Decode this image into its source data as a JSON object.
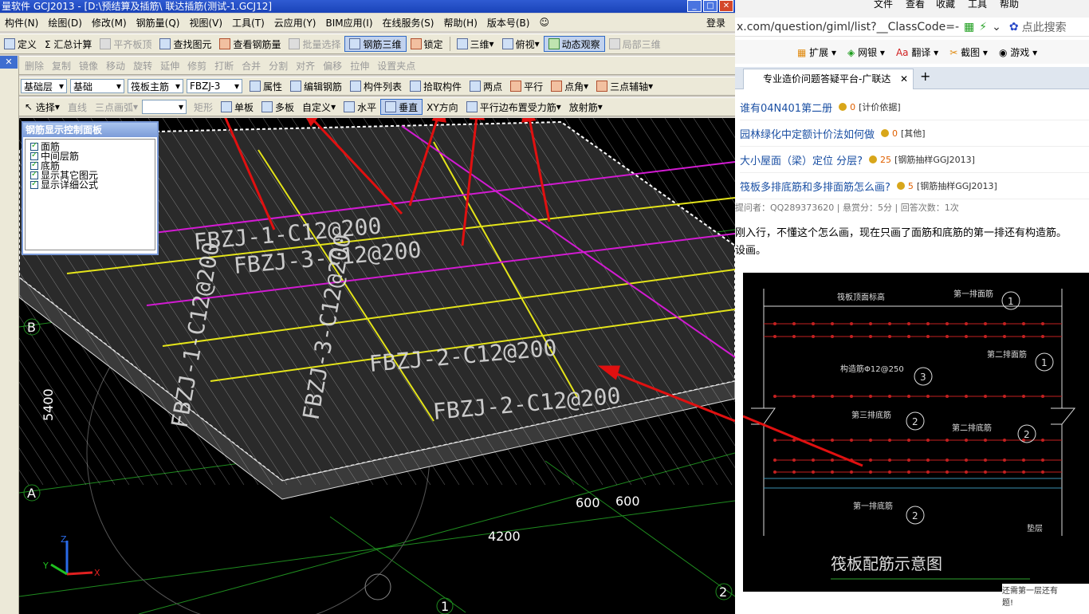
{
  "app": {
    "title": "量软件 GCJ2013 - [D:\\预结算及插筋\\ 联达插筋(测试-1.GCJ12]",
    "menus": [
      "构件(N)",
      "绘图(D)",
      "修改(M)",
      "钢筋量(Q)",
      "视图(V)",
      "工具(T)",
      "云应用(Y)",
      "BIM应用(I)",
      "在线服务(S)",
      "帮助(H)",
      "版本号(B)"
    ],
    "login": "登录",
    "toolbar1": {
      "define": "定义",
      "summary": "Σ 汇总计算",
      "flush": "平齐板顶",
      "find": "查找图元",
      "view_rebar": "查看钢筋量",
      "batch_select": "批量选择",
      "rebar3d": "钢筋三维",
      "lock": "锁定",
      "threed": "三维",
      "topview": "俯视",
      "dynamic": "动态观察",
      "local3d": "局部三维"
    },
    "toolbar2": [
      "删除",
      "复制",
      "镜像",
      "移动",
      "旋转",
      "延伸",
      "修剪",
      "打断",
      "合并",
      "分割",
      "对齐",
      "偏移",
      "拉伸",
      "设置夹点"
    ],
    "toolbar3": {
      "layer": "基础层",
      "category": "基础",
      "component": "筏板主筋",
      "name": "FBZJ-3",
      "props": "属性",
      "edit_rebar": "编辑钢筋",
      "comp_list": "构件列表",
      "pick": "拾取构件",
      "two_points": "两点",
      "parallel": "平行",
      "corner": "点角",
      "three_axis": "三点辅轴"
    },
    "toolbar4": {
      "select": "选择",
      "line": "直线",
      "arc": "三点画弧",
      "rect": "矩形",
      "single": "单板",
      "multi": "多板",
      "custom": "自定义",
      "horizontal": "水平",
      "vertical": "垂直",
      "xy": "XY方向",
      "parallel_edge": "平行边布置受力筋",
      "radial": "放射筋"
    },
    "panel": {
      "title": "钢筋显示控制面板",
      "items": [
        "面筋",
        "中间层筋",
        "底筋",
        "显示其它图元",
        "显示详细公式"
      ]
    },
    "viewport": {
      "labels": [
        "FBZJ-1-C12@200",
        "FBZJ-3-C12@200",
        "FBZJ-2-C12@200",
        "FBZJ-1-C12@200",
        "FBZJ-3-C12@200",
        "FBZJ-2-C12@200"
      ],
      "axis_b": "B",
      "axis_a": "A",
      "dim_5400": "5400",
      "dim_4200": "4200",
      "dim_600a": "600",
      "dim_600b": "600",
      "axis_1": "1",
      "axis_2": "2",
      "tri_x": "X",
      "tri_y": "Y",
      "tri_z": "Z"
    },
    "colors": {
      "grid": "#ffffff",
      "yellow": "#e4e41a",
      "magenta": "#d21ad2",
      "arrow": "#e01010",
      "green": "#1f8c1f"
    }
  },
  "browser": {
    "top": [
      "文件",
      "查看",
      "收藏",
      "工具",
      "帮助"
    ],
    "url": "x.com/question/giml/list?__ClassCode=-",
    "search": "点此搜索",
    "tools": [
      "扩展",
      "网银",
      "翻译",
      "截图",
      "游戏"
    ],
    "tab": "专业造价问题答疑平台-广联达",
    "questions": [
      {
        "title": "谁有04N401第二册",
        "points": "0",
        "tag": "[计价依据]"
      },
      {
        "title": "园林绿化中定额计价法如何做",
        "points": "0",
        "tag": "[其他]"
      },
      {
        "title": "大小屋面（梁）定位 分层?",
        "points": "25",
        "tag": "[钢筋抽样GGJ2013]"
      },
      {
        "title": "筏板多排底筋和多排面筋怎么画?",
        "points": "5",
        "tag": "[钢筋抽样GGJ2013]"
      }
    ],
    "meta": "提问者：QQ289373620  |  悬赏分：5分  |  回答次数：1次",
    "body_line1": "刚入行，不懂这个怎么画，现在只画了面筋和底筋的第一排还有构造筋。",
    "body_line2": "设画。",
    "drawing": {
      "top_elev": "筏板顶面标高",
      "first_top": "第一排面筋",
      "second_top": "第二排面筋",
      "struct": "构造筋Φ12@250",
      "third_bottom": "第三排底筋",
      "second_bottom": "第二排底筋",
      "first_bottom": "第一排底筋",
      "cushion": "垫层",
      "caption": "筏板配筋示意图",
      "c1": "1",
      "c2": "1",
      "c3": "3",
      "c4": "2",
      "c5": "2",
      "c6": "2"
    },
    "corner_text": "还需第一层还有\n题!"
  }
}
